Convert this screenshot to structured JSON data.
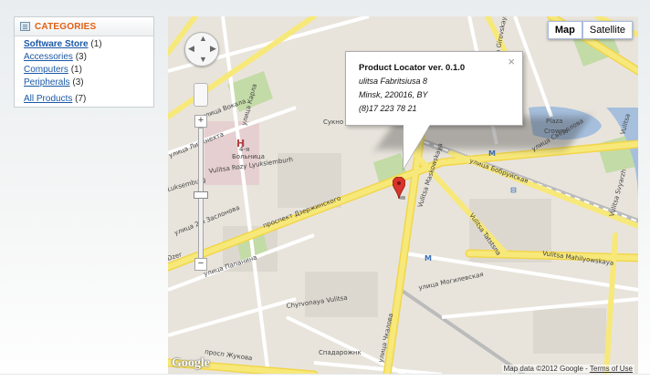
{
  "sidebar": {
    "title": "CATEGORIES",
    "items": [
      {
        "label": "Software Store",
        "count": "(1)"
      },
      {
        "label": "Accessories",
        "count": "(3)"
      },
      {
        "label": "Computers",
        "count": "(1)"
      },
      {
        "label": "Peripherals",
        "count": "(3)"
      }
    ],
    "all": {
      "label": "All Products",
      "count": "(7)"
    }
  },
  "map": {
    "type_buttons": [
      "Map",
      "Satellite"
    ],
    "logo": "Google",
    "attribution": "Map data ©2012 Google",
    "terms": "Terms of Use",
    "zoom_in": "+",
    "zoom_out": "−",
    "infowindow": {
      "title": "Product Locator ver. 0.1.0",
      "street": "ulitsa Fabritsiusa 8",
      "city": "Minsk, 220016, BY",
      "phone": "(8)17 223 78 21",
      "close": "×"
    },
    "labels": {
      "sukno": "Сукно",
      "crowne1": "Crowne",
      "crowne2": "Plaza",
      "hospital1": "4-я",
      "hospital2": "Больница",
      "dzerzh": "проспект Дзержинского",
      "maslow": "Vulitsa Maskowskaya",
      "bobruisk": "улица Бобруйская",
      "sverdlova": "улица Свердлова",
      "tatsiana": "Vulitsa Tatstsna",
      "mahil": "Vulitsa Mahilyowskaya",
      "mahil_ru": "улица Могилевская",
      "chkalova": "улица Чкалова",
      "zhukova": "просп Жукова",
      "chyrv": "Chyrvonaya Vulitsa",
      "sparadz": "Спадарожнк",
      "papanina": "улица Папанина",
      "vokala": "улица Вокала",
      "libkn": "улица Либкнехта",
      "rozy": "Vulitsa Rozy Lyuksiemburh",
      "luxemb": "Luksemburg",
      "kirova": "Vulitsa Girovskaya",
      "karla": "улица Карла",
      "dzer_short": "Dzer",
      "zaslonova": "улица 2-я Заслонова",
      "svyarzh": "Vulitsa Svyarzh",
      "vulitsa_b": "Vulitsa"
    }
  },
  "colors": {
    "accent": "#e25f12",
    "link": "#1a58a6",
    "road_major": "#f7e87a",
    "road_minor": "#ffffff",
    "park": "#c3dba6",
    "water": "#a5bfdd",
    "pin": "#d8342b"
  }
}
